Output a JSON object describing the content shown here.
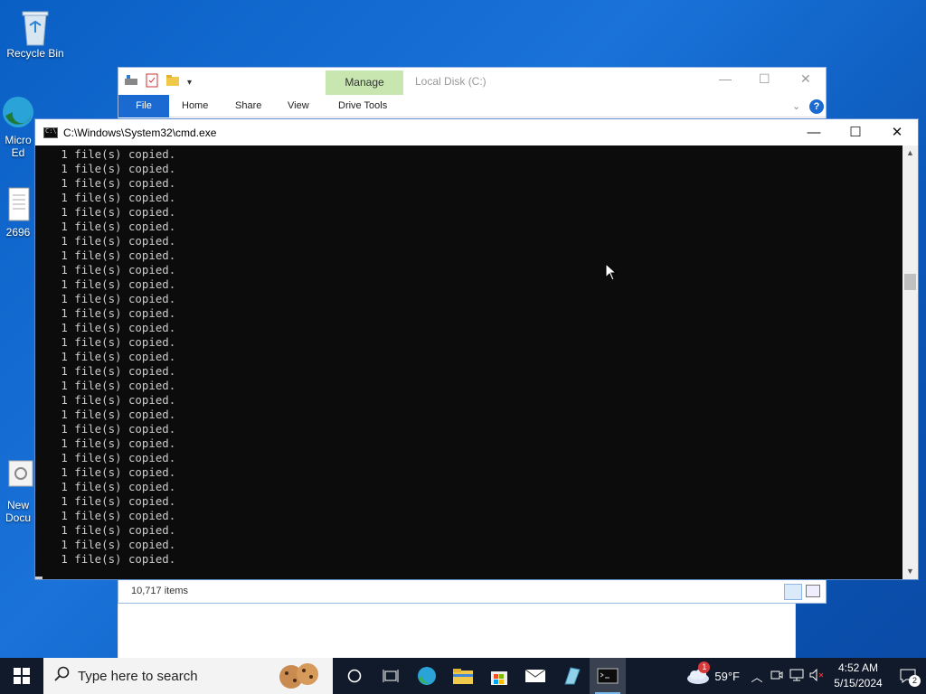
{
  "desktop": {
    "icons": [
      {
        "label": "Recycle Bin"
      },
      {
        "label": "Micro\nEd"
      },
      {
        "label": "2696"
      },
      {
        "label": "New\nDocu"
      }
    ]
  },
  "explorer": {
    "title": "Local Disk (C:)",
    "context_tab": "Manage",
    "tabs": [
      "File",
      "Home",
      "Share",
      "View",
      "Drive Tools"
    ],
    "status_items": "10,717 items"
  },
  "cmd": {
    "title": "C:\\Windows\\System32\\cmd.exe",
    "lines": [
      "   1 file(s) copied.",
      "   1 file(s) copied.",
      "   1 file(s) copied.",
      "   1 file(s) copied.",
      "   1 file(s) copied.",
      "   1 file(s) copied.",
      "   1 file(s) copied.",
      "   1 file(s) copied.",
      "   1 file(s) copied.",
      "   1 file(s) copied.",
      "   1 file(s) copied.",
      "   1 file(s) copied.",
      "   1 file(s) copied.",
      "   1 file(s) copied.",
      "   1 file(s) copied.",
      "   1 file(s) copied.",
      "   1 file(s) copied.",
      "   1 file(s) copied.",
      "   1 file(s) copied.",
      "   1 file(s) copied.",
      "   1 file(s) copied.",
      "   1 file(s) copied.",
      "   1 file(s) copied.",
      "   1 file(s) copied.",
      "   1 file(s) copied.",
      "   1 file(s) copied.",
      "   1 file(s) copied.",
      "   1 file(s) copied.",
      "   1 file(s) copied."
    ]
  },
  "taskbar": {
    "search_placeholder": "Type here to search",
    "weather_temp": "59°F",
    "weather_badge": "1",
    "time": "4:52 AM",
    "date": "5/15/2024",
    "notification_count": "2"
  }
}
